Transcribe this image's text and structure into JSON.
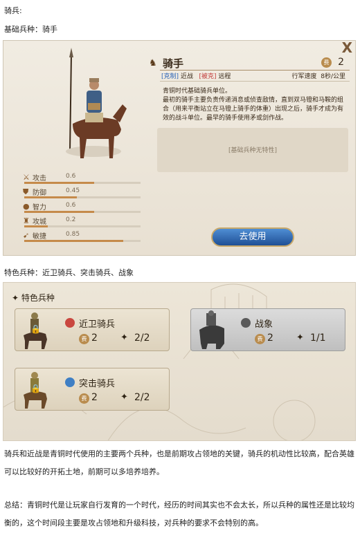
{
  "text": {
    "line1": "骑兵:",
    "line2": "基础兵种：骑手",
    "line3": "特色兵种：近卫骑兵、突击骑兵、战象",
    "para1": "骑兵和近战是青铜时代使用的主要两个兵种，也是前期攻占领地的关键，骑兵的机动性比较高，配合英雄可以比较好的开拓土地，前期可以多培养培养。",
    "para2": "总结：青铜时代是让玩家自行发育的一个时代，经历的时间其实也不会太长，所以兵种的属性还是比较均衡的，这个时间段主要是攻占领地和升级科技，对兵种的要求不会特别的高。"
  },
  "unit_panel": {
    "close": "X",
    "name": "骑手",
    "cost_coin": "费",
    "cost": "2",
    "tag_counter_label": "[克制]",
    "tag_counter_value": "近战",
    "tag_countered_label": "[被克]",
    "tag_countered_value": "远程",
    "speed_label": "行军速度",
    "speed_value": "8秒/公里",
    "description": "青铜时代基础骑兵单位。\n最初的骑手主要负责传递消息或侦查敌情，直到双马镫和马鞍的组合（用来平衡站立在马镫上骑手的体重）出现之后，骑手才成为有效的战斗单位。最早的骑手使用矛或剑作战。",
    "trait": "[基础兵种无特性]",
    "use_button": "去使用",
    "stats": [
      {
        "label": "攻击",
        "value": "0.6",
        "level": 0.6
      },
      {
        "label": "防御",
        "value": "0.45",
        "level": 0.45
      },
      {
        "label": "智力",
        "value": "0.6",
        "level": 0.6
      },
      {
        "label": "攻城",
        "value": "0.2",
        "level": 0.2
      },
      {
        "label": "敏捷",
        "value": "0.85",
        "level": 0.85
      }
    ]
  },
  "special_panel": {
    "title": "特色兵种",
    "cards": [
      {
        "name": "近卫骑兵",
        "coin": "费",
        "cost": "2",
        "ratio": "2/2",
        "star": "✦",
        "locked": true
      },
      {
        "name": "战象",
        "coin": "费",
        "cost": "2",
        "ratio": "1/1",
        "star": "✦",
        "locked": false
      },
      {
        "name": "突击骑兵",
        "coin": "费",
        "cost": "2",
        "ratio": "2/2",
        "star": "✦",
        "locked": true
      }
    ]
  },
  "colors": {
    "accent_blue": "#2a63b8",
    "accent_red": "#c23a3a",
    "bar_fill": "#c58a4a",
    "button_blue": "#1f4f95"
  }
}
